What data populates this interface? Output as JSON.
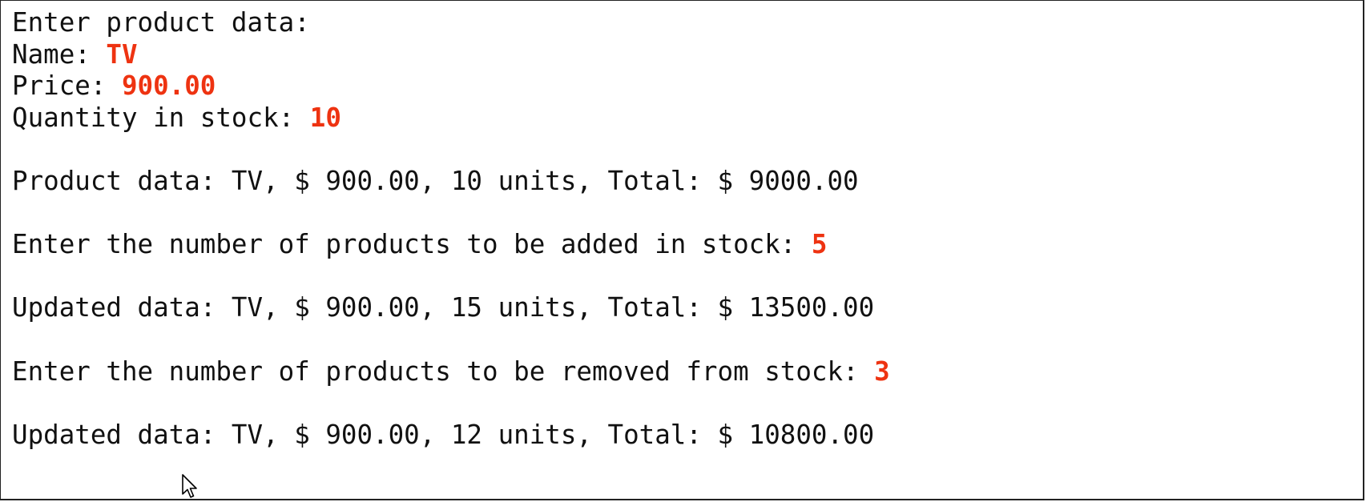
{
  "console": {
    "lines": {
      "header": "Enter product data:",
      "name_prompt": "Name: ",
      "name_value": "TV",
      "price_prompt": "Price: ",
      "price_value": "900.00",
      "quantity_prompt": "Quantity in stock: ",
      "quantity_value": "10",
      "product_data": "Product data: TV, $ 900.00, 10 units, Total: $ 9000.00",
      "add_prompt": "Enter the number of products to be added in stock: ",
      "add_value": "5",
      "updated_after_add": "Updated data: TV, $ 900.00, 15 units, Total: $ 13500.00",
      "remove_prompt": "Enter the number of products to be removed from stock: ",
      "remove_value": "3",
      "updated_after_remove": "Updated data: TV, $ 900.00, 12 units, Total: $ 10800.00"
    },
    "colors": {
      "background": "#ffffff",
      "text": "#111111",
      "user_input": "#ee3311"
    },
    "cursor_icon": "mouse-pointer-icon"
  }
}
